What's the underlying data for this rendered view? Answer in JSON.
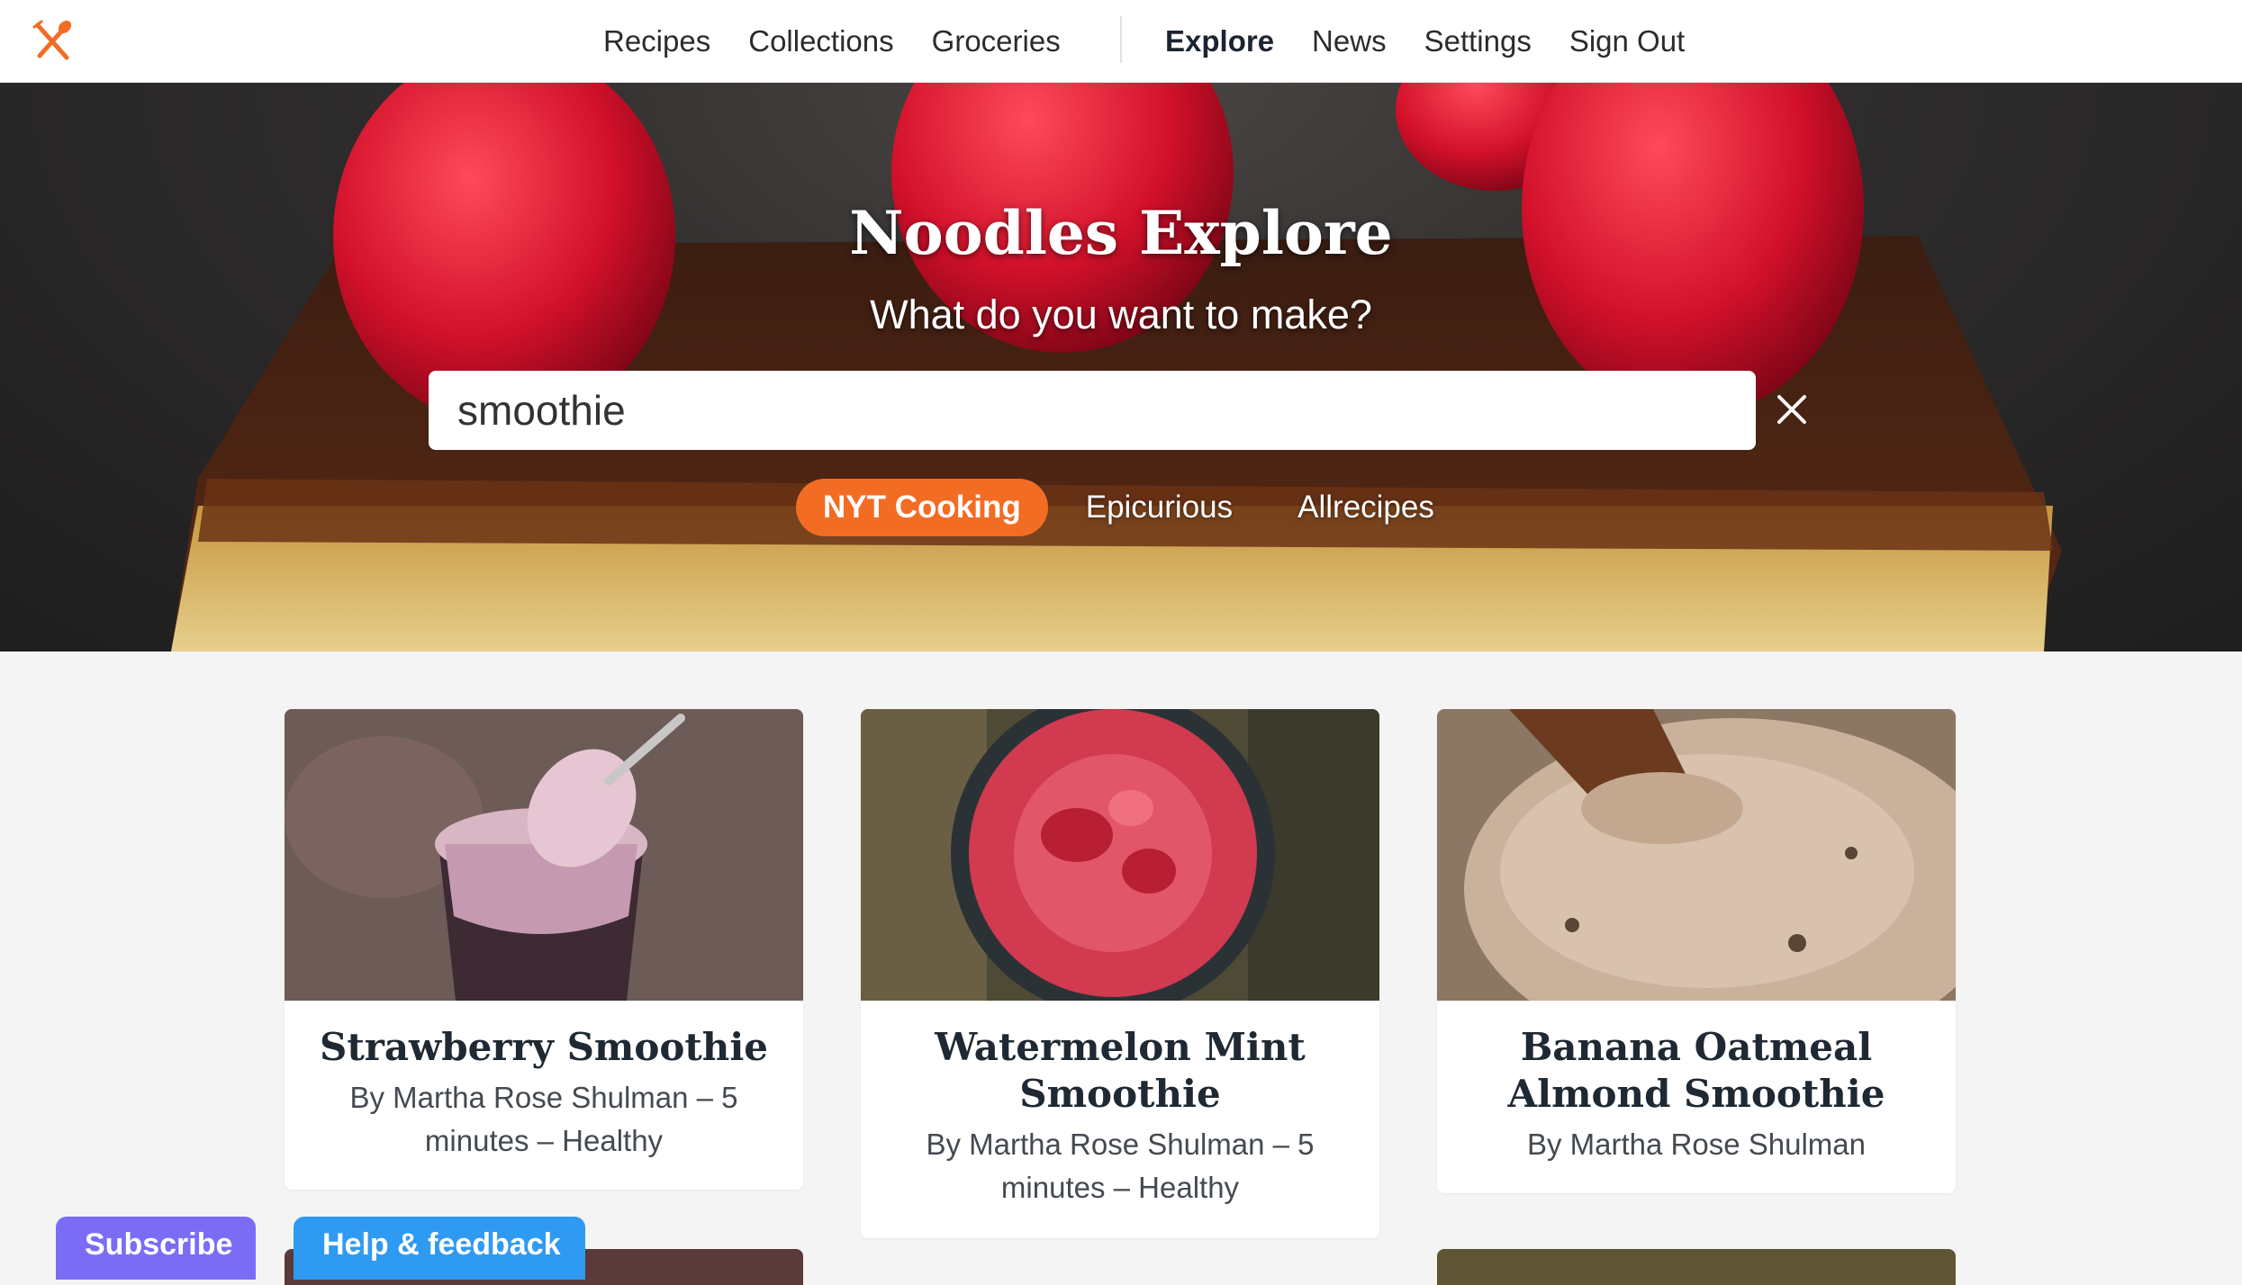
{
  "app": {
    "logo_icon": "fork-spoon-icon",
    "accent": "#f26c24"
  },
  "nav": {
    "left": [
      "Recipes",
      "Collections",
      "Groceries"
    ],
    "right": [
      "Explore",
      "News",
      "Settings",
      "Sign Out"
    ],
    "active": "Explore"
  },
  "hero": {
    "title": "Noodles Explore",
    "subtitle": "What do you want to make?",
    "search_value": "smoothie",
    "clear_icon": "close-icon",
    "sources": [
      "NYT Cooking",
      "Epicurious",
      "Allrecipes"
    ],
    "active_source": "NYT Cooking"
  },
  "cards": [
    {
      "title": "Strawberry Smoothie",
      "meta": "By Martha Rose Shulman – 5 minutes – Healthy"
    },
    {
      "title": "Watermelon Mint Smoothie",
      "meta": "By Martha Rose Shulman – 5 minutes – Healthy"
    },
    {
      "title": "Banana Oatmeal Almond Smoothie",
      "meta": "By Martha Rose Shulman"
    }
  ],
  "footer_buttons": {
    "subscribe": "Subscribe",
    "help": "Help & feedback",
    "subscribe_color": "#7b6cf6",
    "help_color": "#2f9af2"
  }
}
